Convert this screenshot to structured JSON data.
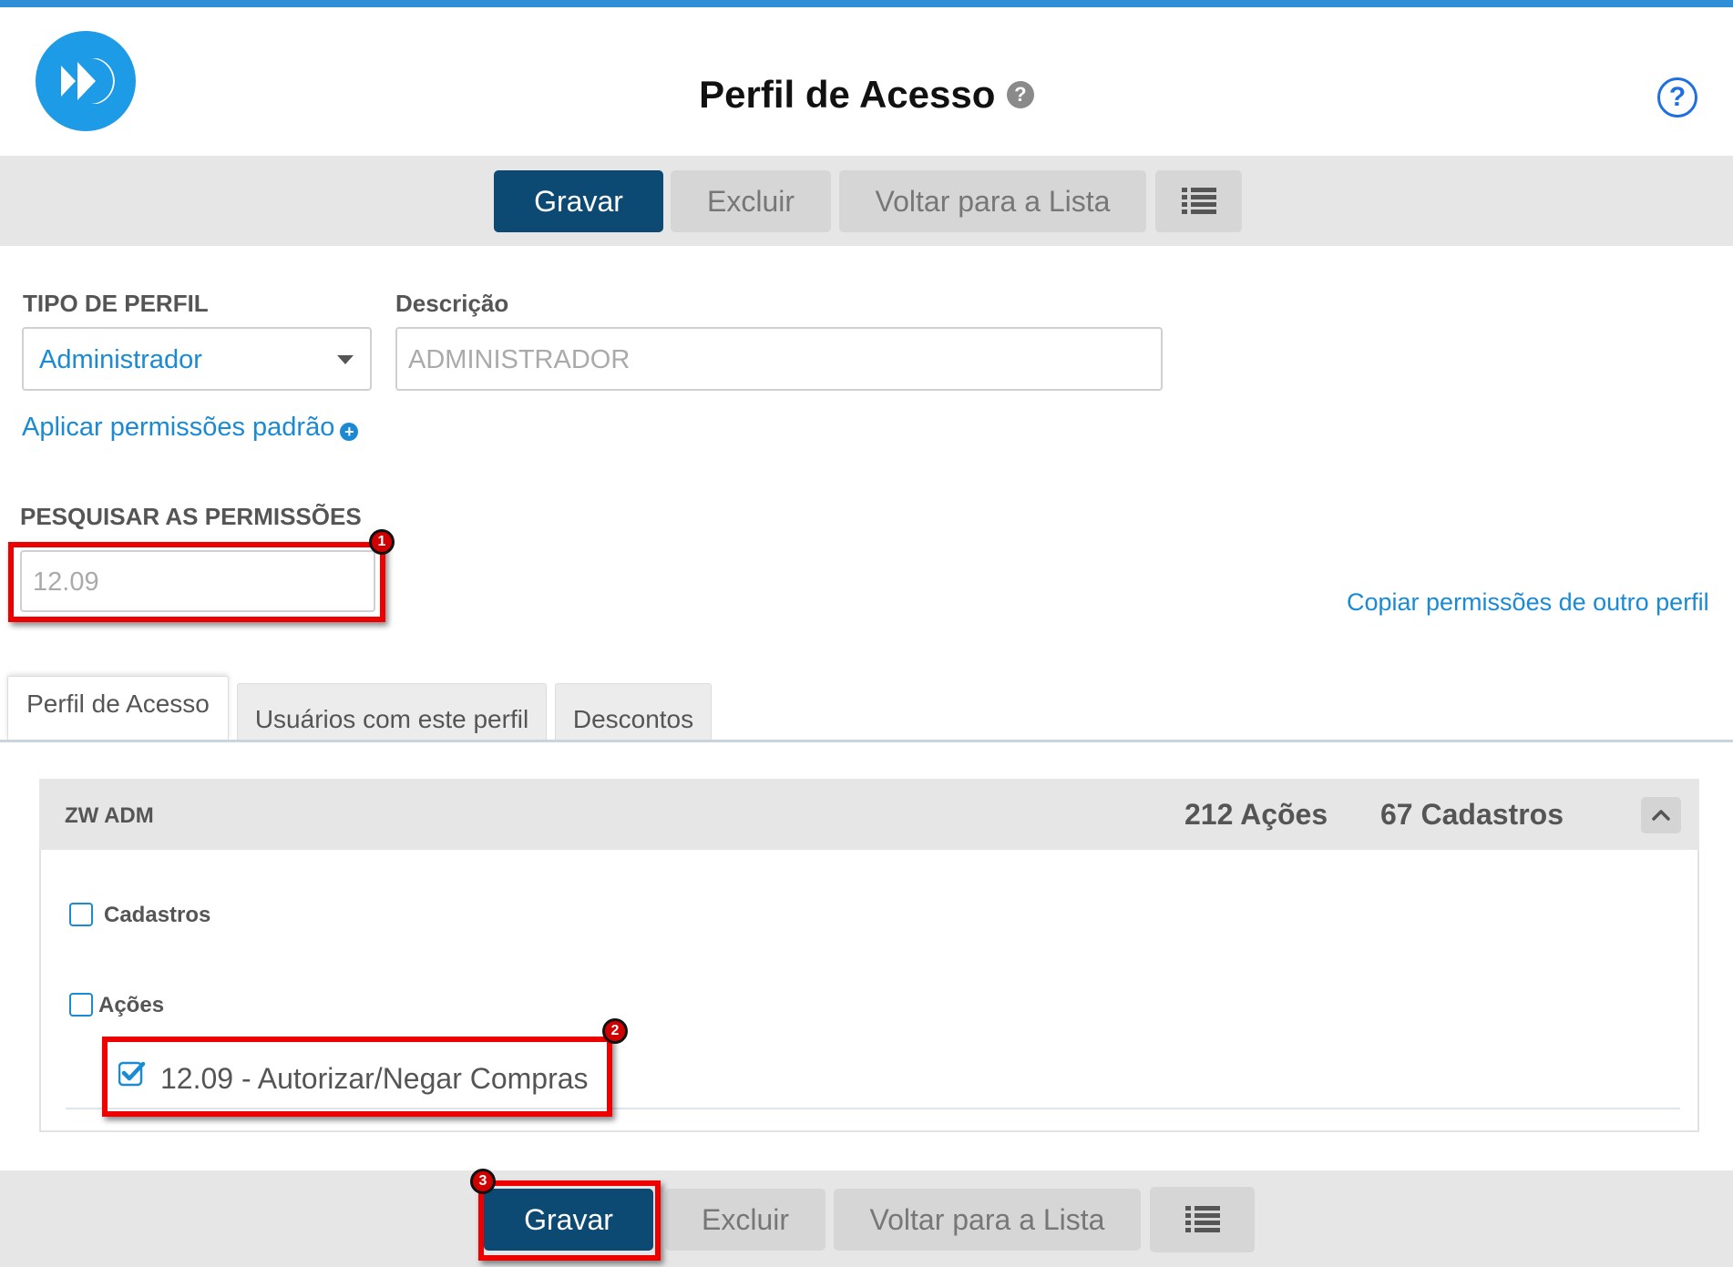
{
  "header": {
    "title": "Perfil de Acesso",
    "title_help_glyph": "?",
    "help_glyph": "?"
  },
  "toolbar": {
    "save_label": "Gravar",
    "delete_label": "Excluir",
    "back_label": "Voltar para a Lista"
  },
  "form": {
    "profile_type_label": "TIPO DE PERFIL",
    "profile_type_value": "Administrador",
    "description_label": "Descrição",
    "description_value": "ADMINISTRADOR",
    "apply_defaults_link": "Aplicar permissões padrão",
    "search_label": "PESQUISAR AS PERMISSÕES",
    "search_value": "12.09",
    "copy_link": "Copiar permissões de outro perfil"
  },
  "tabs": [
    {
      "label": "Perfil de Acesso",
      "active": true
    },
    {
      "label": "Usuários com este perfil",
      "active": false
    },
    {
      "label": "Descontos",
      "active": false
    }
  ],
  "panel": {
    "title": "ZW ADM",
    "actions_count": "212 Ações",
    "registers_count": "67 Cadastros",
    "registers_checkbox_label": "Cadastros",
    "registers_checked": false,
    "actions_checkbox_label": "Ações",
    "actions_checked": false,
    "items": [
      {
        "label": "12.09 - Autorizar/Negar Compras",
        "checked": true
      }
    ]
  },
  "annotations": {
    "step1": "1",
    "step2": "2",
    "step3": "3"
  },
  "colors": {
    "accent": "#1a8ad4",
    "primary_button": "#0c4a73",
    "highlight": "#ee0000",
    "top_bar": "#2f8ed6"
  },
  "icons": {
    "logo": "fast-forward-logo",
    "list": "list-icon",
    "help": "question-circle-icon",
    "collapse": "chevron-up-icon",
    "dropdown": "caret-down-icon",
    "add": "plus-circle-icon"
  }
}
